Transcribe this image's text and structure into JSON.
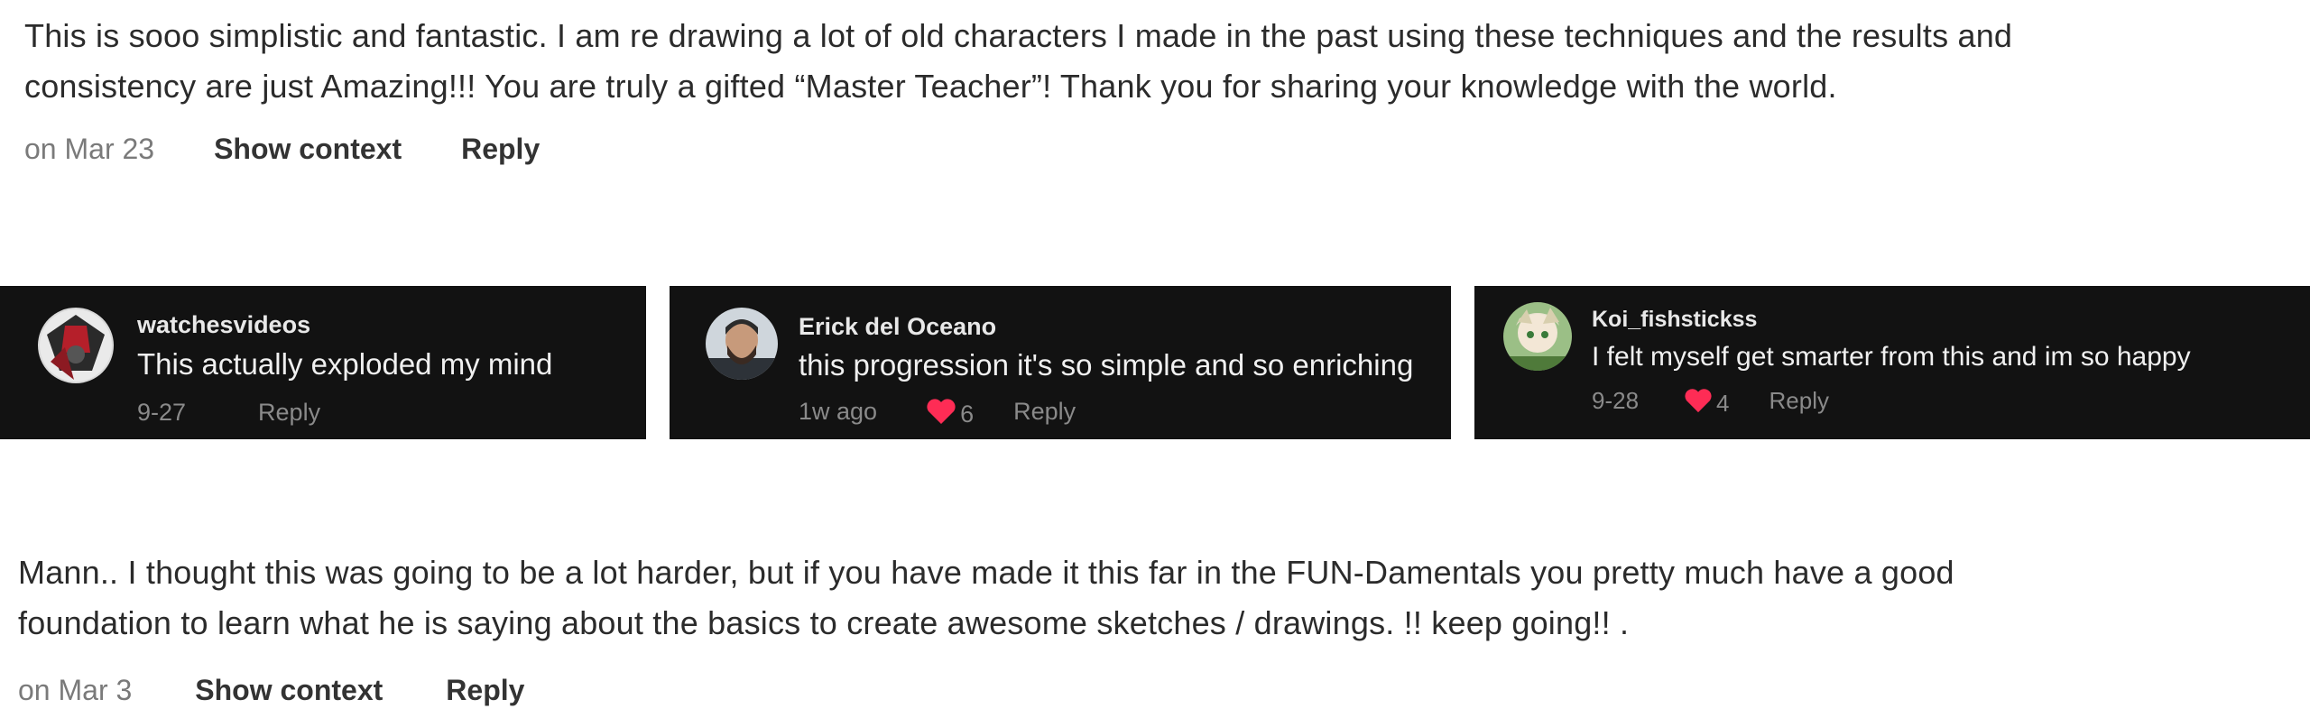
{
  "comment1": {
    "text": "This is sooo simplistic and fantastic. I am re drawing a lot of old characters I made in the past using these techniques and the results and\nconsistency are just Amazing!!! You are truly a gifted “Master Teacher”! Thank you for sharing your knowledge with the world.",
    "date": "on Mar 23",
    "show_context": "Show context",
    "reply": "Reply"
  },
  "cards": [
    {
      "username": "watchesvideos",
      "text": "This actually exploded my mind",
      "date": "9-27",
      "reply": "Reply",
      "avatar": "avatar-watchesvideos"
    },
    {
      "username": "Erick del Oceano",
      "text": "this progression it's so simple and so enriching",
      "date": "1w ago",
      "likes": "6",
      "reply": "Reply",
      "avatar": "avatar-erick"
    },
    {
      "username": "Koi_fishstickss",
      "text": "I felt myself get smarter from this and im so happy",
      "date": "9-28",
      "likes": "4",
      "reply": "Reply",
      "avatar": "avatar-koi"
    }
  ],
  "comment2": {
    "text": "Mann.. I thought this was going to be a lot harder, but if you have made it this far in the FUN-Damentals you pretty much have a good\nfoundation to learn what he is saying about the basics to create awesome sketches / drawings. !! keep going!! .",
    "date": "on Mar 3",
    "show_context": "Show context",
    "reply": "Reply"
  },
  "colors": {
    "heart": "#fe2c55",
    "card_bg": "#121212"
  },
  "icons": [
    "heart-icon"
  ]
}
